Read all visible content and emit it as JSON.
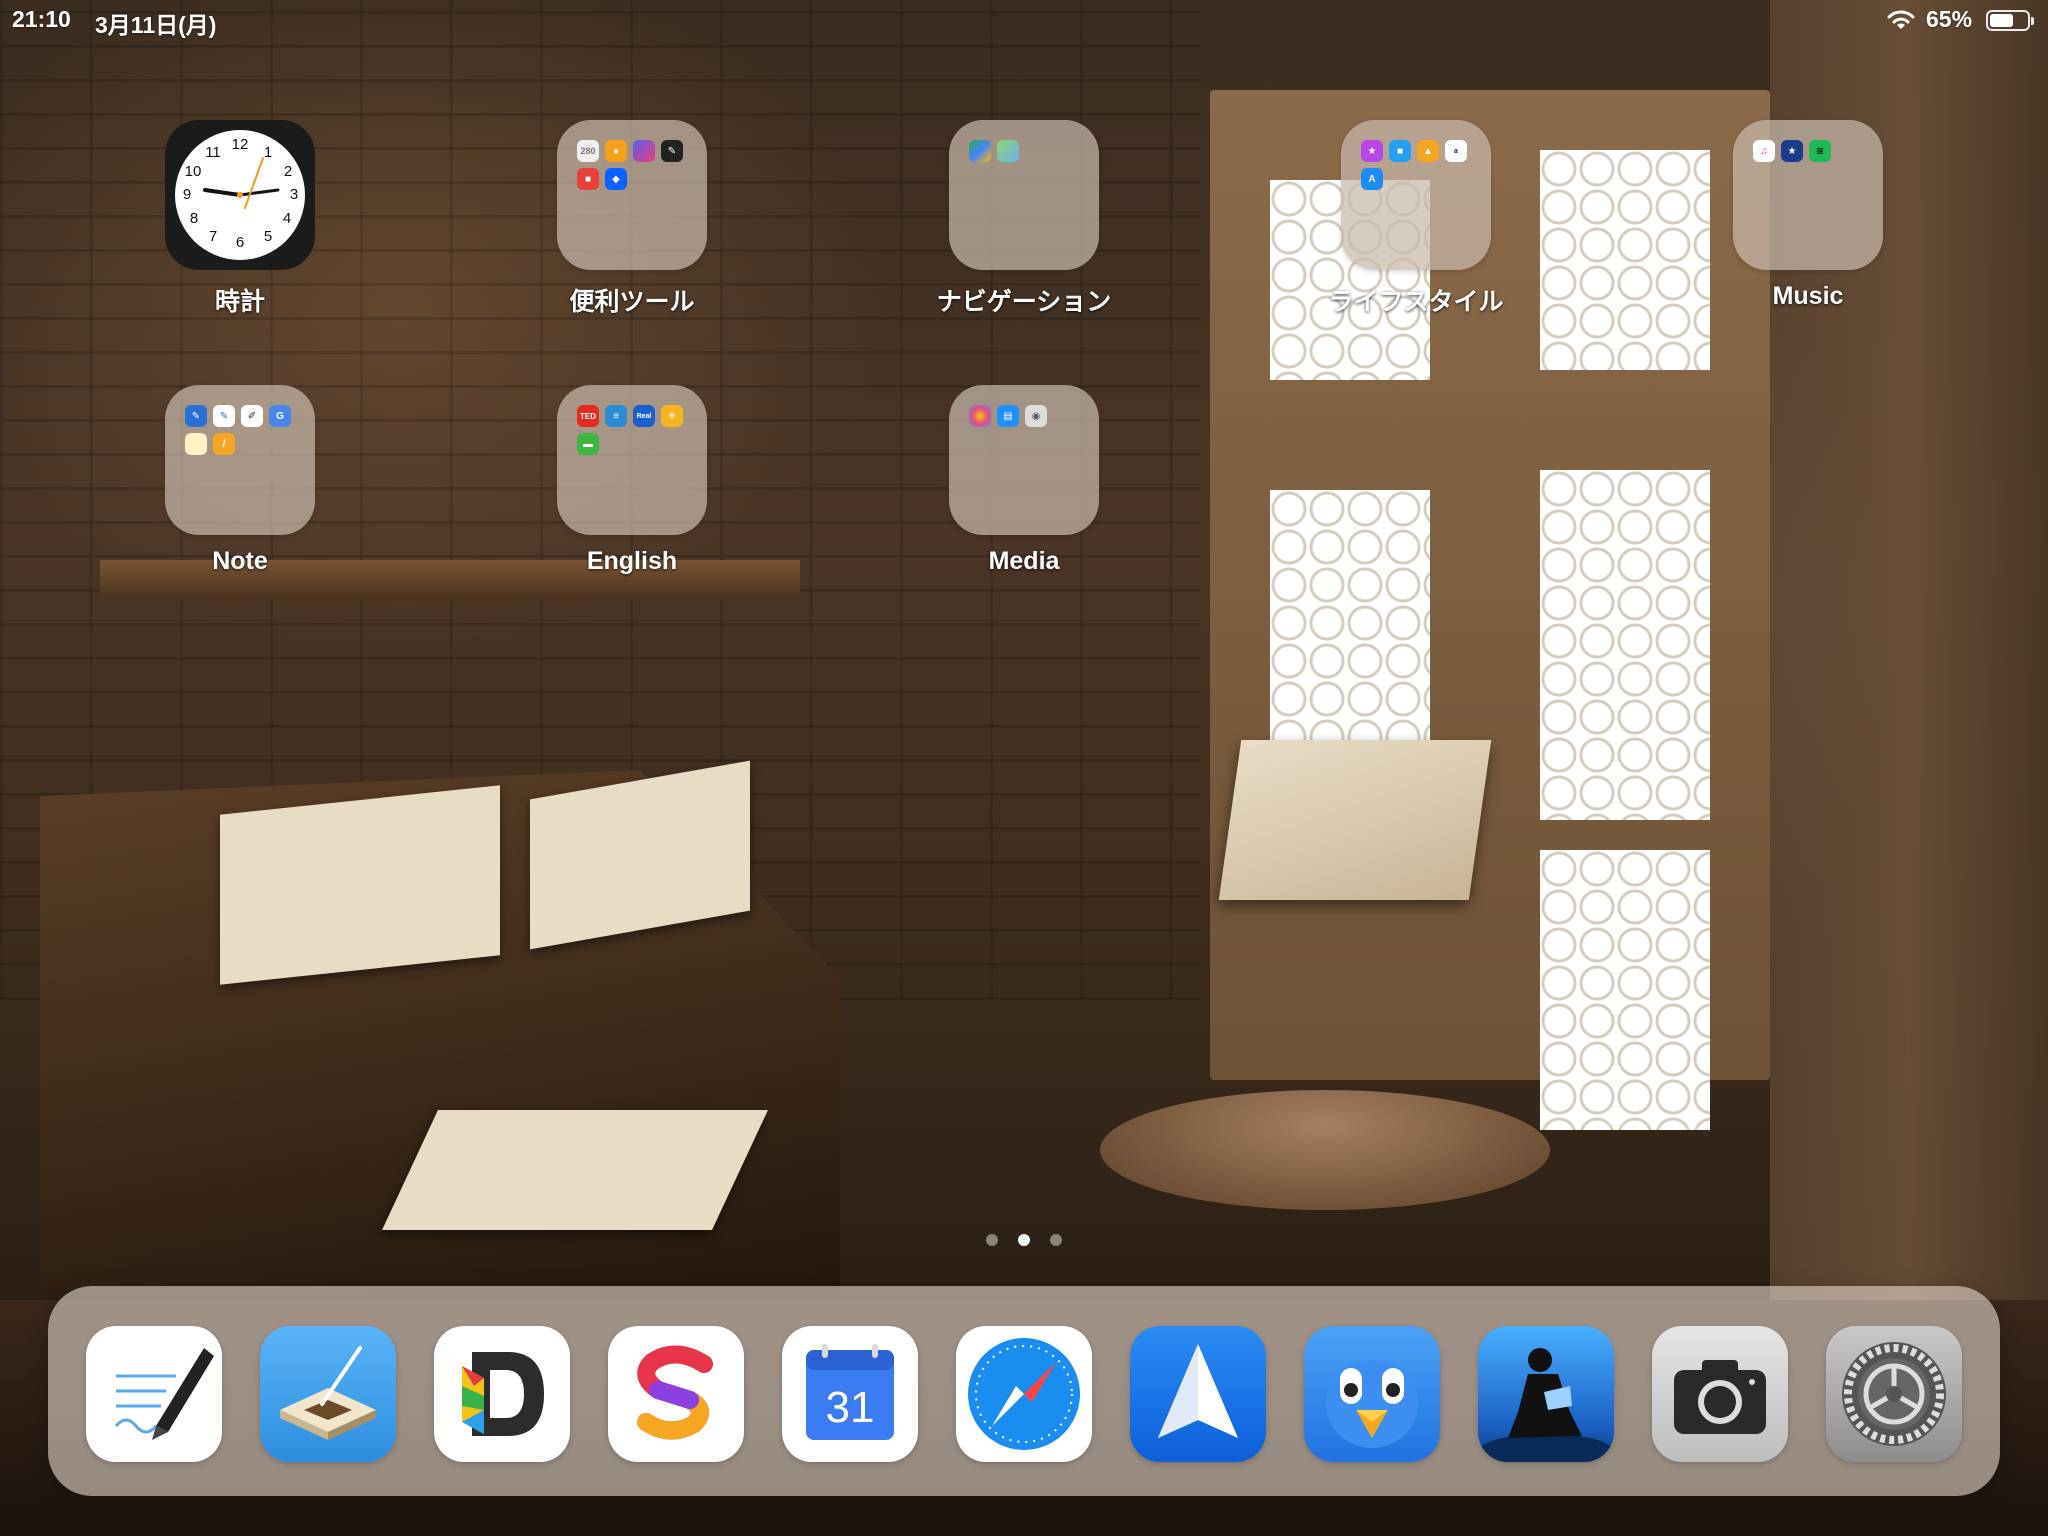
{
  "status_bar": {
    "time": "21:10",
    "date": "3月11日(月)",
    "battery_percent": "65%",
    "battery_level": 0.65,
    "wifi_icon": "wifi-icon"
  },
  "home_apps": [
    {
      "label": "時計",
      "type": "app",
      "icon": "clock-icon"
    },
    {
      "label": "便利ツール",
      "type": "folder"
    },
    {
      "label": "ナビゲーション",
      "type": "folder"
    },
    {
      "label": "ライフスタイル",
      "type": "folder"
    },
    {
      "label": "Music",
      "type": "folder"
    },
    {
      "label": "Note",
      "type": "folder"
    },
    {
      "label": "English",
      "type": "folder"
    },
    {
      "label": "Media",
      "type": "folder"
    }
  ],
  "folder_minis": {
    "benri": [
      "280",
      "",
      "",
      "",
      "",
      ""
    ],
    "english": [
      "TED",
      "",
      "Real",
      "",
      ""
    ]
  },
  "clock_numbers": [
    "12",
    "1",
    "2",
    "3",
    "4",
    "5",
    "6",
    "7",
    "8",
    "9",
    "10",
    "11"
  ],
  "page_indicator": {
    "count": 3,
    "active": 2
  },
  "dock": {
    "apps": [
      {
        "icon": "pen-notes-icon"
      },
      {
        "icon": "notebook-icon"
      },
      {
        "icon": "documents-d-icon"
      },
      {
        "icon": "s-letter-app-icon"
      },
      {
        "icon": "calendar-icon",
        "text": "31"
      },
      {
        "icon": "safari-compass-icon"
      },
      {
        "icon": "spark-mail-icon"
      },
      {
        "icon": "tweetbot-bird-icon"
      },
      {
        "icon": "kindle-reader-icon"
      },
      {
        "icon": "camera-icon"
      },
      {
        "icon": "settings-gear-icon"
      }
    ]
  },
  "colors": {
    "folder_bg": "#c8b9aa",
    "dock_bg": "#e1d4c8",
    "safari_blue": "#1b8cf0",
    "spark_blue": "#1a76e8",
    "tweetbot_blue": "#2f8ff0",
    "calendar_blue": "#3b7cf2"
  }
}
